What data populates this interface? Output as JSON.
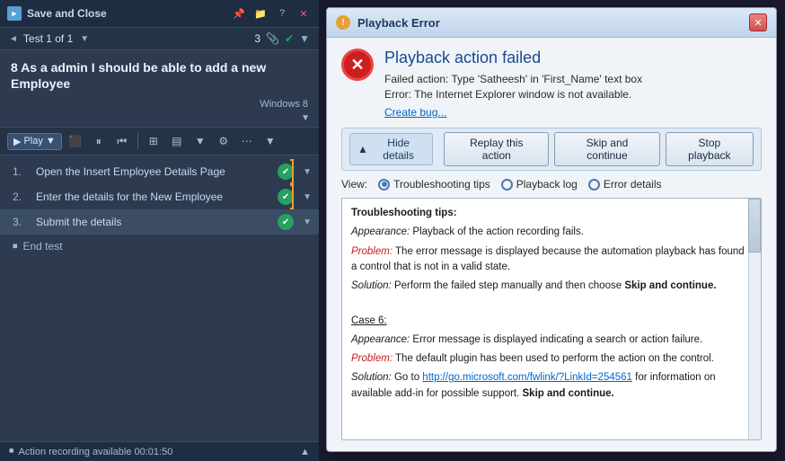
{
  "left_panel": {
    "titlebar": {
      "icon_text": "►",
      "title": "Save and Close",
      "help_btn": "?",
      "pin_btn": "📌",
      "folder_btn": "📁",
      "close_btn": "✕"
    },
    "breadcrumb": {
      "text": "Test 1 of 1",
      "count": "3",
      "dropdown_arrow": "▼"
    },
    "test_title": "8 As a admin I should be able to add a new Employee",
    "windows_label": "Windows 8",
    "toolbar": {
      "play_label": "Play",
      "dropdown": "▼"
    },
    "steps": [
      {
        "num": "1.",
        "text": "Open the Insert Employee Details Page",
        "checked": true
      },
      {
        "num": "2.",
        "text": "Enter the details for the New Employee",
        "checked": true
      },
      {
        "num": "3.",
        "text": "Submit the details",
        "checked": true
      }
    ],
    "end_test_label": "End test",
    "statusbar": {
      "text": "Action recording available 00:01:50"
    }
  },
  "dialog": {
    "title": "Playback Error",
    "error_title": "Playback action failed",
    "failed_action": "Failed action: Type 'Satheesh' in 'First_Name' text box",
    "error_message": "Error: The Internet Explorer window is not available.",
    "create_bug_link": "Create bug...",
    "hide_details_btn": "Hide details",
    "replay_btn": "Replay this action",
    "skip_btn": "Skip and continue",
    "stop_btn": "Stop playback",
    "view_label": "View:",
    "radio_options": [
      {
        "label": "Troubleshooting tips",
        "selected": true
      },
      {
        "label": "Playback log",
        "selected": false
      },
      {
        "label": "Error details",
        "selected": false
      }
    ],
    "content": {
      "heading": "Troubleshooting tips:",
      "lines": [
        {
          "type": "italic-label",
          "label": "Appearance:",
          "text": " Playback of the action recording fails."
        },
        {
          "type": "red-italic-label",
          "label": "Problem:",
          "text": " The error message is displayed because the automation playback has found a control that is not in a valid state."
        },
        {
          "type": "italic-label",
          "label": "Solution:",
          "text": " Perform the failed step manually and then choose ",
          "bold_end": "Skip and continue."
        },
        {
          "type": "blank"
        },
        {
          "type": "underline-label",
          "label": "Case 6:"
        },
        {
          "type": "italic-label",
          "label": "Appearance:",
          "text": " Error message is displayed indicating a search or action failure."
        },
        {
          "type": "red-italic-label",
          "label": "Problem:",
          "text": " The default plugin has been used to perform the action on the control."
        },
        {
          "type": "italic-label",
          "label": "Solution:",
          "text": " Go to http://go.microsoft.com/fwlink/?LinkId=254561 for information on available add-in for possible support. ",
          "bold_end": "Skip and continue."
        }
      ]
    }
  }
}
